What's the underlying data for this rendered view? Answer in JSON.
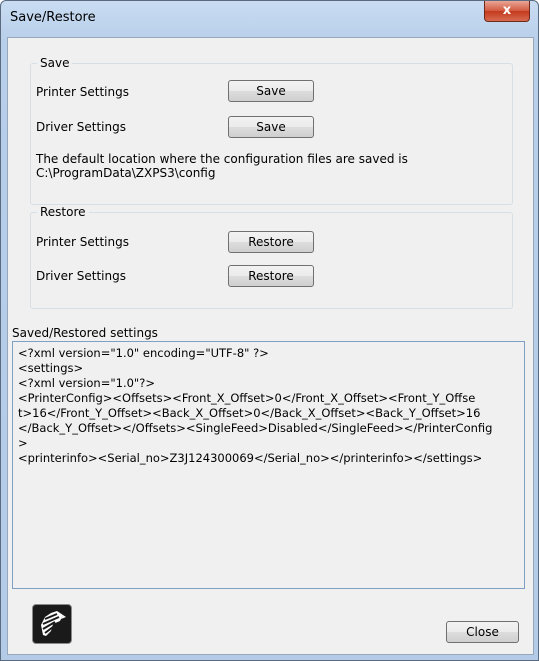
{
  "window": {
    "title": "Save/Restore",
    "close_glyph": "x"
  },
  "save": {
    "group_label": "Save",
    "printer_label": "Printer Settings",
    "printer_button": "Save",
    "driver_label": "Driver Settings",
    "driver_button": "Save",
    "info_line1": "The default location where the configuration files are saved is",
    "info_line2": "C:\\ProgramData\\ZXPS3\\config"
  },
  "restore": {
    "group_label": "Restore",
    "printer_label": "Printer Settings",
    "printer_button": "Restore",
    "driver_label": "Driver Settings",
    "driver_button": "Restore"
  },
  "settings": {
    "label": "Saved/Restored settings",
    "lines": [
      "<?xml version=\"1.0\" encoding=\"UTF-8\" ?>",
      "<settings>",
      "<?xml version=\"1.0\"?>",
      "<PrinterConfig><Offsets><Front_X_Offset>0</Front_X_Offset><Front_Y_Offse",
      "t>16</Front_Y_Offset><Back_X_Offset>0</Back_X_Offset><Back_Y_Offset>16",
      "</Back_Y_Offset></Offsets><SingleFeed>Disabled</SingleFeed></PrinterConfig",
      ">",
      "<printerinfo><Serial_no>Z3J124300069</Serial_no></printerinfo></settings>"
    ]
  },
  "footer": {
    "logo_icon": "zebra-logo-icon",
    "close_button": "Close"
  }
}
